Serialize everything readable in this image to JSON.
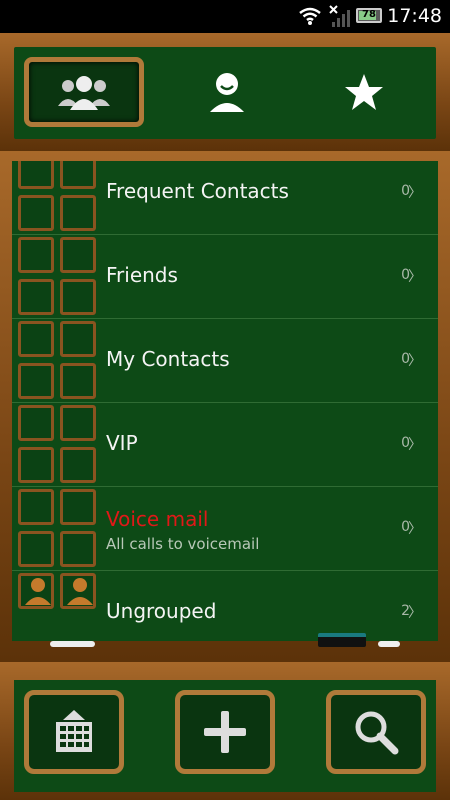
{
  "status": {
    "time": "17:48",
    "battery": "78"
  },
  "tabs": [
    {
      "name": "groups",
      "active": true
    },
    {
      "name": "contact",
      "active": false
    },
    {
      "name": "favorites",
      "active": false
    }
  ],
  "groups": [
    {
      "name": "Frequent Contacts",
      "count": "0",
      "chevron": "〉"
    },
    {
      "name": "Friends",
      "count": "0",
      "chevron": "〉"
    },
    {
      "name": "My Contacts",
      "count": "0",
      "chevron": "〉"
    },
    {
      "name": "VIP",
      "count": "0",
      "chevron": "〉"
    },
    {
      "name": "Voice mail",
      "subtitle": "All calls to voicemail",
      "count": "0",
      "chevron": "〉"
    },
    {
      "name": "Ungrouped",
      "count": "2",
      "chevron": "〉"
    }
  ],
  "colors": {
    "board": "#0d4a16",
    "wood": "#7a4615",
    "voicemail": "#e01818"
  },
  "bottom": {
    "buttons": [
      "grid-icon",
      "add-icon",
      "search-icon"
    ]
  }
}
